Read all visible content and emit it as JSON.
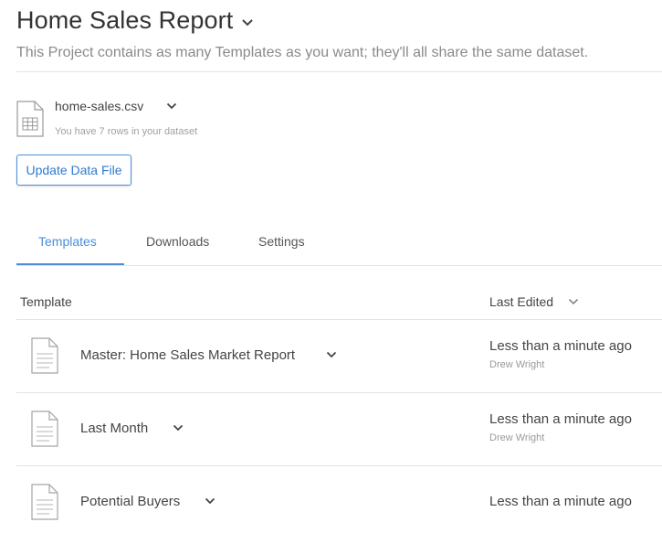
{
  "header": {
    "title": "Home Sales Report",
    "subtitle": "This Project contains as many Templates as you want; they'll all share the same dataset."
  },
  "dataset": {
    "file_name": "home-sales.csv",
    "rows_text": "You have 7 rows in your dataset",
    "update_button": "Update Data File"
  },
  "tabs": [
    {
      "label": "Templates",
      "active": true
    },
    {
      "label": "Downloads",
      "active": false
    },
    {
      "label": "Settings",
      "active": false
    }
  ],
  "table": {
    "col_template": "Template",
    "col_last_edited": "Last Edited",
    "rows": [
      {
        "name": "Master: Home Sales Market Report",
        "time": "Less than a minute ago",
        "user": "Drew Wright"
      },
      {
        "name": "Last Month",
        "time": "Less than a minute ago",
        "user": "Drew Wright"
      },
      {
        "name": "Potential Buyers",
        "time": "Less than a minute ago",
        "user": ""
      }
    ]
  },
  "colors": {
    "accent": "#4a90d9",
    "divider": "#e3e3e3"
  }
}
